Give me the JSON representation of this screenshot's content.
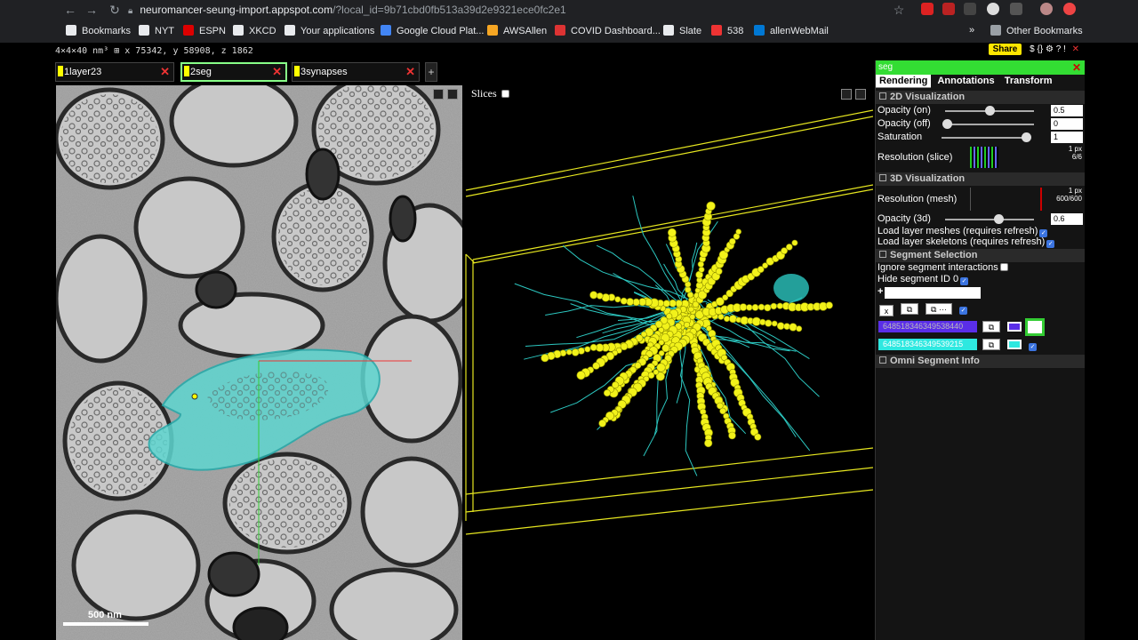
{
  "browser": {
    "url_host": "neuromancer-seung-import.appspot.com",
    "url_path": "/?local_id=9b71cbd0fb513a39d2e9321ece0fc2e1",
    "bookmarks": [
      {
        "label": "Bookmarks",
        "icon": "star-icon",
        "color": "#e8eaed"
      },
      {
        "label": "NYT",
        "icon": "nyt-icon",
        "color": "#e8eaed"
      },
      {
        "label": "ESPN",
        "icon": "espn-icon",
        "color": "#d00"
      },
      {
        "label": "XKCD",
        "icon": "xkcd-icon",
        "color": "#e8eaed"
      },
      {
        "label": "Your applications",
        "icon": "globe-icon",
        "color": "#e8eaed"
      },
      {
        "label": "Google Cloud Plat...",
        "icon": "gcloud-icon",
        "color": "#4285f4"
      },
      {
        "label": "AWSAllen",
        "icon": "aws-icon",
        "color": "#f6a623"
      },
      {
        "label": "COVID Dashboard...",
        "icon": "covid-icon",
        "color": "#d33"
      },
      {
        "label": "Slate",
        "icon": "slate-icon",
        "color": "#e8eaed"
      },
      {
        "label": "538",
        "icon": "fivethirtyeight-icon",
        "color": "#e33"
      },
      {
        "label": "allenWebMail",
        "icon": "outlook-icon",
        "color": "#0078d4"
      }
    ],
    "other_bookmarks": "Other Bookmarks",
    "more_bookmarks": "»"
  },
  "viewer": {
    "coords": "4×4×40 nm³ ⊞ x 75342, y 58908, z 1862",
    "share": "Share",
    "top_icons": "$ {} ⚙ ? !",
    "layers": [
      {
        "num": "1",
        "name": "layer23",
        "selected": false
      },
      {
        "num": "2",
        "name": "seg",
        "selected": true
      },
      {
        "num": "3",
        "name": "synapses",
        "selected": false
      }
    ],
    "add_layer": "+",
    "slices_label": "Slices",
    "scalebar": "500 nm"
  },
  "sidepanel": {
    "title": "seg",
    "close": "✕",
    "tabs": [
      "Rendering",
      "Annotations",
      "Transform"
    ],
    "sec2d": "2D Visualization",
    "opacity_on_label": "Opacity (on)",
    "opacity_on": "0.5",
    "opacity_off_label": "Opacity (off)",
    "opacity_off": "0",
    "saturation_label": "Saturation",
    "saturation": "1",
    "res_slice_label": "Resolution (slice)",
    "res_slice_px": "1 px",
    "res_slice_count": "6/6",
    "sec3d": "3D Visualization",
    "res_mesh_label": "Resolution (mesh)",
    "res_mesh_px": "1 px",
    "res_mesh_count": "600/600",
    "opacity3d_label": "Opacity (3d)",
    "opacity3d": "0.6",
    "load_meshes": "Load layer meshes (requires refresh)",
    "load_skeletons": "Load layer skeletons (requires refresh)",
    "sec_segsel": "Segment Selection",
    "ignore_seg": "Ignore segment interactions",
    "hide_seg0": "Hide segment ID 0",
    "add_prefix": "+",
    "clear_btn": "x",
    "segments": [
      {
        "id": "648518346349538440",
        "color": "#5a2ee8"
      },
      {
        "id": "648518346349539215",
        "color": "#2ee8e0"
      }
    ],
    "sec_omni": "Omni Segment Info"
  }
}
